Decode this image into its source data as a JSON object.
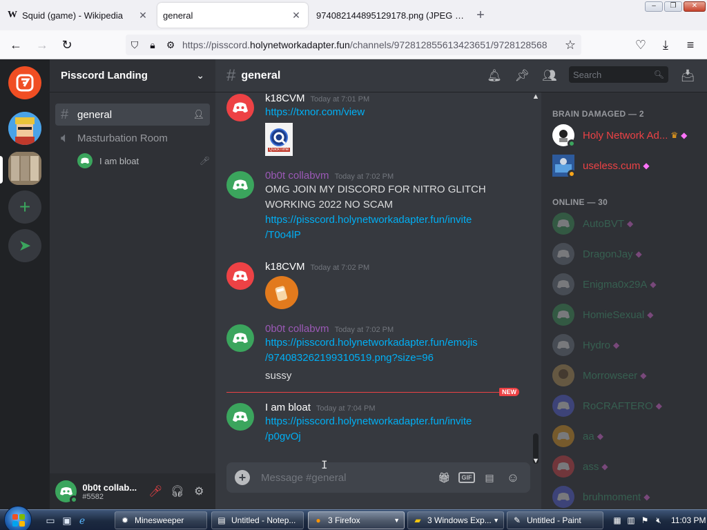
{
  "browser": {
    "tabs": [
      {
        "label": "Squid (game) - Wikipedia",
        "favicon": "W"
      },
      {
        "label": "general",
        "favicon": ""
      },
      {
        "label": "974082144895129178.png (JPEG Ima",
        "favicon": ""
      }
    ],
    "url_prefix": "https://pisscord.",
    "url_host": "holynetworkadapter.fun",
    "url_path": "/channels/972812855613423651/9728128568"
  },
  "guild": {
    "name": "Pisscord Landing",
    "channels": [
      {
        "name": "general",
        "type": "text"
      },
      {
        "name": "Masturbation Room",
        "type": "voice"
      }
    ],
    "voice_users": [
      {
        "name": "I am bloat"
      }
    ]
  },
  "user_panel": {
    "name": "0b0t collab...",
    "tag": "#5582"
  },
  "chat": {
    "channel_name": "general",
    "search_placeholder": "Search",
    "composer_placeholder": "Message #general",
    "new_badge": "NEW",
    "gif_label": "GIF",
    "messages": [
      {
        "author": "k18CVM",
        "time": "Today at 7:01 PM",
        "link": "https://txnor.com/view",
        "attachment": "QuickTime",
        "author_color": "#ffffff"
      },
      {
        "author": "0b0t collabvm",
        "time": "Today at 7:02 PM",
        "text": "OMG JOIN MY DISCORD FOR NITRO GLITCH WORKING 2022 NO SCAM",
        "link_line1": "https://pisscord.holynetworkadapter.fun/invite",
        "link_line2": "/T0o4lP",
        "author_color": "#9b59b6"
      },
      {
        "author": "k18CVM",
        "time": "Today at 7:02 PM",
        "author_color": "#ffffff"
      },
      {
        "author": "0b0t collabvm",
        "time": "Today at 7:02 PM",
        "link_line1": "https://pisscord.holynetworkadapter.fun/emojis",
        "link_line2": "/974083262199310519.png?size=96",
        "text": "sussy",
        "author_color": "#9b59b6"
      },
      {
        "author": "I am bloat",
        "time": "Today at 7:04 PM",
        "link_line1": "https://pisscord.holynetworkadapter.fun/invite",
        "link_line2": "/p0gvOj",
        "author_color": "#ffffff"
      }
    ]
  },
  "members": {
    "group1_header": "BRAIN DAMAGED — 2",
    "group2_header": "ONLINE — 30",
    "group1": [
      {
        "name": "Holy Network Ad...",
        "color": "#ed4245"
      },
      {
        "name": "useless.cum",
        "color": "#ed4245"
      }
    ],
    "group2": [
      {
        "name": "AutoBVT",
        "color": "#43b581"
      },
      {
        "name": "DragonJay",
        "color": "#43b581"
      },
      {
        "name": "Enigma0x29A",
        "color": "#43b581"
      },
      {
        "name": "HomieSexual",
        "color": "#43b581"
      },
      {
        "name": "Hydro",
        "color": "#43b581"
      },
      {
        "name": "Morrowseer",
        "color": "#43b581"
      },
      {
        "name": "RoCRAFTERO",
        "color": "#43b581"
      },
      {
        "name": "aa",
        "color": "#43b581"
      },
      {
        "name": "ass",
        "color": "#43b581"
      },
      {
        "name": "bruhmoment",
        "color": "#43b581"
      }
    ]
  },
  "taskbar": {
    "tasks": [
      {
        "label": "Minesweeper"
      },
      {
        "label": "Untitled - Notep..."
      },
      {
        "label": "3 Firefox"
      },
      {
        "label": "3 Windows Exp..."
      },
      {
        "label": "Untitled - Paint"
      }
    ],
    "clock": "11:03 PM"
  }
}
